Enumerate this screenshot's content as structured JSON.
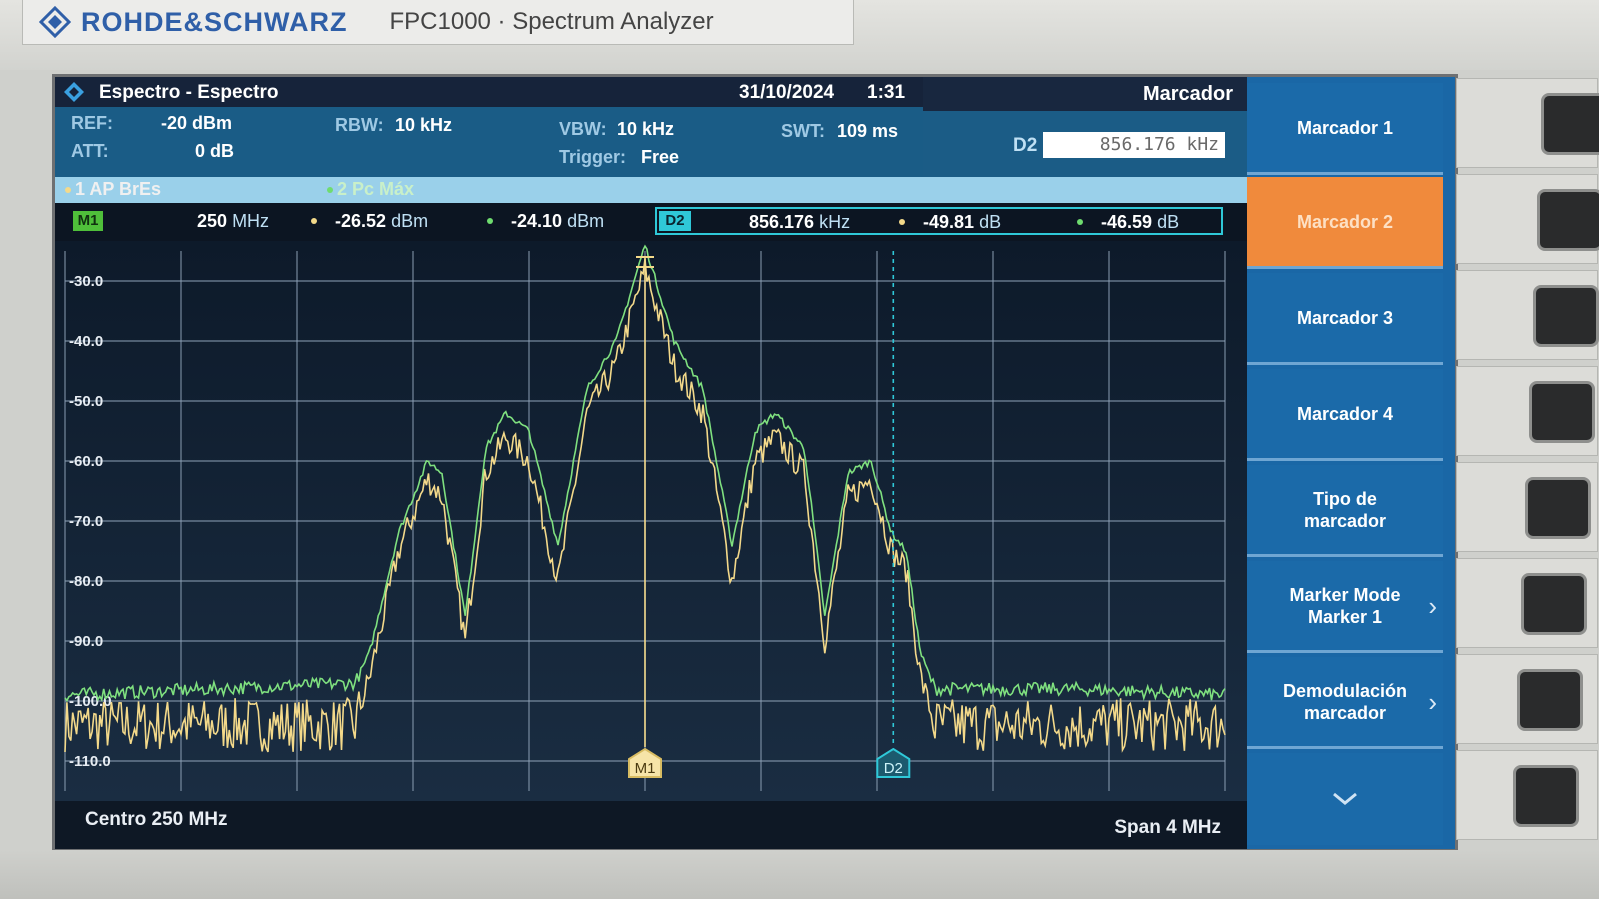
{
  "brand": {
    "name": "ROHDE&SCHWARZ",
    "model": "FPC1000 · Spectrum Analyzer",
    "logo_icon": "rs-diamond-logo-icon"
  },
  "titlebar": {
    "title": "Espectro - Espectro",
    "date": "31/10/2024",
    "time": "1:31",
    "app_icon": "spectrum-diamond-icon"
  },
  "settings": {
    "ref_label": "REF:",
    "ref_value": "-20 dBm",
    "att_label": "ATT:",
    "att_value": "0 dB",
    "rbw_label": "RBW:",
    "rbw_value": "10 kHz",
    "vbw_label": "VBW:",
    "vbw_value": "10 kHz",
    "trigger_label": "Trigger:",
    "trigger_value": "Free",
    "swt_label": "SWT:",
    "swt_value": "109 ms"
  },
  "traces": {
    "trace1": "1 AP  BrEs",
    "trace2": "2 Pc  Máx"
  },
  "entry": {
    "label": "D2",
    "value": "856.176 kHz"
  },
  "marker_m1": {
    "tag": "M1",
    "freq": "250",
    "freq_unit": "MHz",
    "t1": "-26.52",
    "t1_unit": "dBm",
    "t2": "-24.10",
    "t2_unit": "dBm"
  },
  "marker_d2": {
    "tag": "D2",
    "freq": "856.176",
    "freq_unit": "kHz",
    "t1": "-49.81",
    "t1_unit": "dB",
    "t2": "-46.59",
    "t2_unit": "dB"
  },
  "plot": {
    "y_ticks": [
      "-30.0",
      "-40.0",
      "-50.0",
      "-60.0",
      "-70.0",
      "-80.0",
      "-90.0",
      "-100.0",
      "-110.0"
    ],
    "m1_label": "M1",
    "d2_label": "D2",
    "colors": {
      "trace_yellow": "#f3d98a",
      "trace_green": "#7fe07f",
      "marker_d2": "#2fc8d8",
      "grid": "#8fa3b8"
    }
  },
  "footer": {
    "center": "Centro 250 MHz",
    "span": "Span 4 MHz"
  },
  "softkeys": {
    "title": "Marcador",
    "items": [
      {
        "label": "Marcador 1"
      },
      {
        "label": "Marcador 2"
      },
      {
        "label": "Marcador 3"
      },
      {
        "label": "Marcador 4"
      },
      {
        "label": "Tipo de\nmarcador"
      },
      {
        "label": "Marker Mode\nMarker 1"
      },
      {
        "label": "Demodulación\nmarcador"
      }
    ],
    "more_icon": "chevron-down-icon"
  },
  "chart_data": {
    "type": "line",
    "xlabel": "",
    "ylabel": "",
    "x_center_mhz": 250,
    "span_mhz": 4,
    "ylim": [
      -115,
      -25
    ],
    "series": [
      {
        "name": "1 AP BrEs",
        "color": "#f3d98a",
        "x": [
          -2,
          -1.5,
          -1.0,
          -0.95,
          -0.85,
          -0.75,
          -0.7,
          -0.62,
          -0.55,
          -0.48,
          -0.4,
          -0.3,
          -0.2,
          -0.1,
          0,
          0.1,
          0.2,
          0.3,
          0.38,
          0.45,
          0.55,
          0.62,
          0.7,
          0.78,
          0.85,
          0.9,
          0.95,
          1.0,
          1.5,
          2
        ],
        "y": [
          -104,
          -104,
          -104,
          -96,
          -75,
          -63,
          -66,
          -90,
          -62,
          -56,
          -60,
          -80,
          -52,
          -44,
          -28,
          -44,
          -52,
          -80,
          -60,
          -56,
          -62,
          -90,
          -66,
          -63,
          -75,
          -78,
          -96,
          -104,
          -104,
          -104
        ]
      },
      {
        "name": "2 Pc Máx",
        "color": "#7fe07f",
        "x": [
          -2,
          -1.5,
          -1.0,
          -0.95,
          -0.85,
          -0.75,
          -0.7,
          -0.62,
          -0.55,
          -0.48,
          -0.4,
          -0.3,
          -0.2,
          -0.1,
          0,
          0.1,
          0.2,
          0.3,
          0.38,
          0.45,
          0.55,
          0.62,
          0.7,
          0.78,
          0.85,
          0.9,
          0.95,
          1.0,
          1.5,
          2
        ],
        "y": [
          -99,
          -98,
          -97,
          -92,
          -72,
          -60,
          -62,
          -86,
          -58,
          -52,
          -55,
          -74,
          -48,
          -40,
          -24,
          -40,
          -48,
          -74,
          -55,
          -52,
          -58,
          -86,
          -62,
          -60,
          -72,
          -75,
          -92,
          -98,
          -98,
          -99
        ]
      }
    ]
  }
}
